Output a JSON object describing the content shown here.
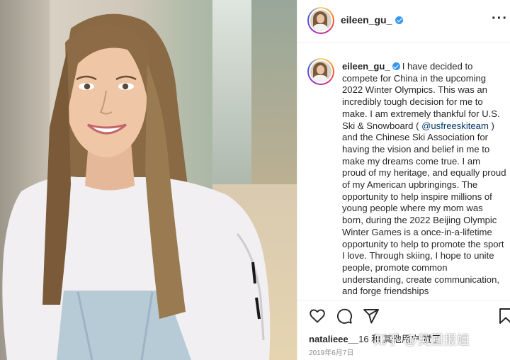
{
  "post": {
    "username": "eileen_gu_",
    "caption_intro": "I have decided to compete for China in the upcoming 2022 Winter Olympics. This was an incredibly tough decision for me to make. I am extremely thankful for U.S. Ski & Snowboard ( ",
    "mention": "@usfreeskiteam",
    "caption_rest": " ) and the Chinese Ski Association for having the vision and belief in me to make my dreams come true. I am proud of my heritage, and equally proud of my American upbringings. The opportunity to help inspire millions of young people where my mom was born, during the 2022 Beijing Olympic Winter Games is a once-in-a-lifetime opportunity to help to promote the sport I love. Through skiing, I hope to unite people, promote common understanding, create communication, and forge friendships",
    "likes_user": "natalieee__",
    "likes_rest": "16 和 其他用户 赞了",
    "date": "2019年6月7日"
  },
  "watermark": "知乎 @英国报姐",
  "colors": {
    "verified": "#3897f0",
    "mention": "#00376b",
    "text": "#262626",
    "muted": "#8e8e8e"
  },
  "icons": [
    "more-horizontal-icon",
    "verified-badge-icon",
    "heart-icon",
    "comment-icon",
    "share-icon",
    "bookmark-icon"
  ]
}
